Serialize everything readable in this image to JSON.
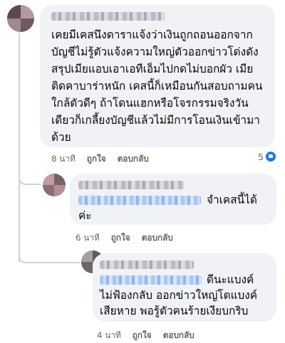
{
  "comment1": {
    "lines": [
      "เคยมีเคสนึงดาราแจ้งว่าเงินถูกถอนออกจาก",
      "บัญชีไม่รู้ตัวแจ้งความใหญ่ตัวออกข่าวโด่งดัง",
      "สรุปเมียแอบเอาเอทีเอ็มไปกดไม่บอกผัว เมีย",
      "ติดคาบาร่าหนัก เคสนี้ก็เหมือนกันสอบถามคน",
      "ใกล้ตัวดีๆ ถ้าโดนแฮกหรือโจรกรรมจริงวัน",
      "เดียวก็เกลี้ยงบัญชีแล้วไม่มีการโอนเงินเข้ามา",
      "ด้วย"
    ],
    "time": "8 นาที",
    "like": "ถูกใจ",
    "reply": "ตอบกลับ",
    "reaction_count": "5"
  },
  "reply1": {
    "line1_after_mention": "จำเคสนี้ได้",
    "line2": "ค่ะ",
    "time": "6 นาที",
    "like": "ถูกใจ",
    "reply": "ตอบกลับ"
  },
  "reply2": {
    "line1_after_mention": "ดีนะแบงค์",
    "line2": "ไม่ฟ้องกลับ ออกข่าวใหญ่โตแบงค์",
    "line3": "เสียหาย พอรู้ตัวคนร้ายเงียบกริบ",
    "time": "4 นาที",
    "like": "ถูกใจ",
    "reply": "ตอบกลับ"
  },
  "colors": {
    "bubble": "#f0f2f5",
    "meta": "#65676b",
    "mention": "#a9c7f3",
    "reaction": "#1877f2"
  }
}
